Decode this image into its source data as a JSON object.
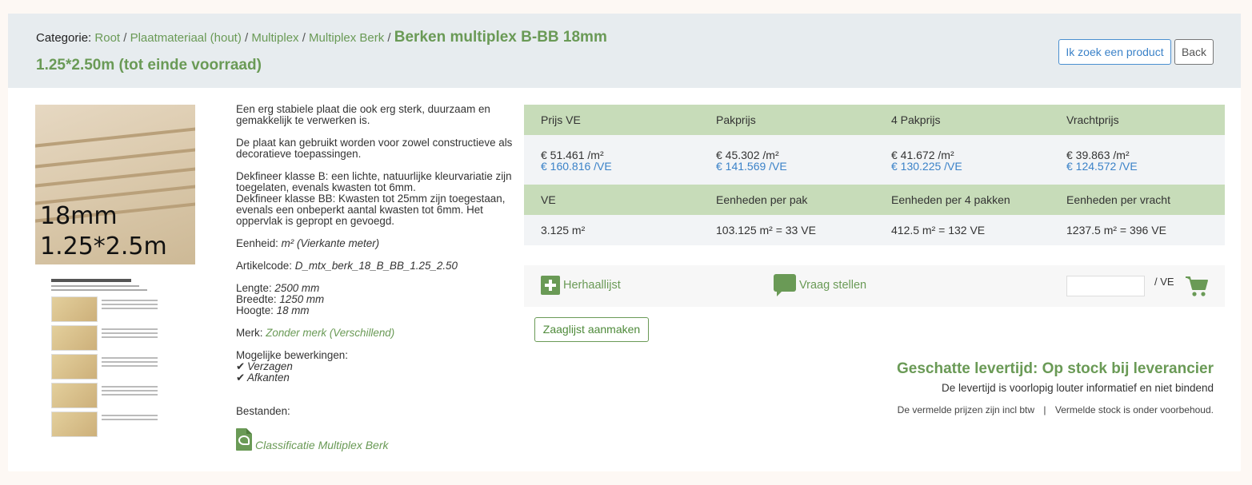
{
  "breadcrumb": {
    "label": "Categorie:",
    "items": [
      "Root",
      "Plaatmateriaal (hout)",
      "Multiplex",
      "Multiplex Berk"
    ],
    "separator": "/",
    "current_line1": "Berken multiplex B-BB 18mm",
    "current_line2": "1.25*2.50m (tot einde voorraad)"
  },
  "header_buttons": {
    "search": "Ik zoek een product",
    "back": "Back"
  },
  "product_image": {
    "line1": "18mm",
    "line2": "1.25*2.5m"
  },
  "description": {
    "p1": "Een erg stabiele plaat die ook erg sterk, duurzaam en gemakkelijk te verwerken is.",
    "p2": "De plaat kan gebruikt worden voor zowel constructieve als decoratieve toepassingen.",
    "p3a": "Dekfineer klasse B: een lichte, natuurlijke kleurvariatie zijn toegelaten, evenals kwasten tot 6mm.",
    "p3b": "Dekfineer klasse BB: Kwasten tot 25mm zijn toegestaan, evenals een onbeperkt aantal kwasten tot 6mm. Het oppervlak is gepropt en gevoegd.",
    "unit_label": "Eenheid:",
    "unit_value": "m² (Vierkante meter)",
    "article_label": "Artikelcode:",
    "article_value": "D_mtx_berk_18_B_BB_1.25_2.50",
    "length_label": "Lengte:",
    "length_value": "2500 mm",
    "width_label": "Breedte:",
    "width_value": "1250 mm",
    "height_label": "Hoogte:",
    "height_value": "18 mm",
    "brand_label": "Merk:",
    "brand_value": "Zonder merk (Verschillend)",
    "processing_label": "Mogelijke bewerkingen:",
    "processing": [
      "Verzagen",
      "Afkanten"
    ],
    "files_label": "Bestanden:",
    "file_link": "Classificatie Multiplex Berk"
  },
  "price_table": {
    "headers": [
      "Prijs VE",
      "Pakprijs",
      "4 Pakprijs",
      "Vrachtprijs"
    ],
    "prices_m2": [
      "€ 51.461 /m²",
      "€ 45.302 /m²",
      "€ 41.672 /m²",
      "€ 39.863 /m²"
    ],
    "prices_ve": [
      "€ 160.816 /VE",
      "€ 141.569 /VE",
      "€ 130.225 /VE",
      "€ 124.572 /VE"
    ],
    "unit_headers": [
      "VE",
      "Eenheden per pak",
      "Eenheden per 4 pakken",
      "Eenheden per vracht"
    ],
    "unit_values": [
      "3.125 m²",
      "103.125 m² = 33 VE",
      "412.5 m² = 132 VE",
      "1237.5 m² = 396 VE"
    ]
  },
  "actions": {
    "repeat_list": "Herhaallijst",
    "ask_question": "Vraag stellen",
    "qty_value": "",
    "qty_unit": "/ VE"
  },
  "saw_list_button": "Zaaglijst aanmaken",
  "delivery": {
    "title": "Geschatte levertijd: Op stock bij leverancier",
    "subtitle": "De levertijd is voorlopig louter informatief en niet bindend",
    "note_vat": "De vermelde prijzen zijn incl btw",
    "note_sep": "|",
    "note_stock": "Vermelde stock is onder voorbehoud."
  },
  "colors": {
    "accent_green": "#6a9a56",
    "table_header": "#c7dcb9",
    "link_blue": "#3b82c8"
  }
}
